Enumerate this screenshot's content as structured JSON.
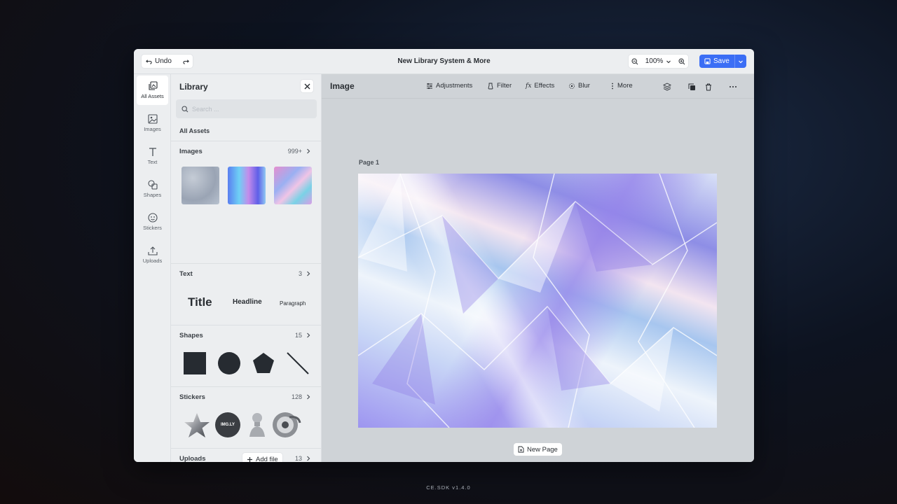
{
  "topbar": {
    "undo_label": "Undo",
    "title": "New Library System & More",
    "zoom_value": "100%",
    "save_label": "Save"
  },
  "rail": {
    "items": [
      {
        "label": "All Assets",
        "icon": "all-assets-icon"
      },
      {
        "label": "Images",
        "icon": "image-icon"
      },
      {
        "label": "Text",
        "icon": "text-icon"
      },
      {
        "label": "Shapes",
        "icon": "shapes-icon"
      },
      {
        "label": "Stickers",
        "icon": "sticker-icon"
      },
      {
        "label": "Uploads",
        "icon": "upload-icon"
      }
    ]
  },
  "library": {
    "title": "Library",
    "search_placeholder": "Search ...",
    "all_assets_label": "All Assets",
    "sections": {
      "images": {
        "label": "Images",
        "count": "999+"
      },
      "text": {
        "label": "Text",
        "count": "3",
        "samples": [
          "Title",
          "Headline",
          "Paragraph"
        ]
      },
      "shapes": {
        "label": "Shapes",
        "count": "15"
      },
      "stickers": {
        "label": "Stickers",
        "count": "128",
        "badge_text": "IMG.LY"
      },
      "uploads": {
        "label": "Uploads",
        "count": "13",
        "add_label": "Add file"
      }
    }
  },
  "main": {
    "title": "Image",
    "tools": [
      "Adjustments",
      "Filter",
      "Effects",
      "Blur",
      "More"
    ],
    "page_label": "Page 1",
    "new_page_label": "New Page"
  },
  "footer": {
    "version": "CE.SDK v1.4.0"
  },
  "colors": {
    "accent": "#3b6ef5",
    "shape_fill": "#262b31"
  }
}
